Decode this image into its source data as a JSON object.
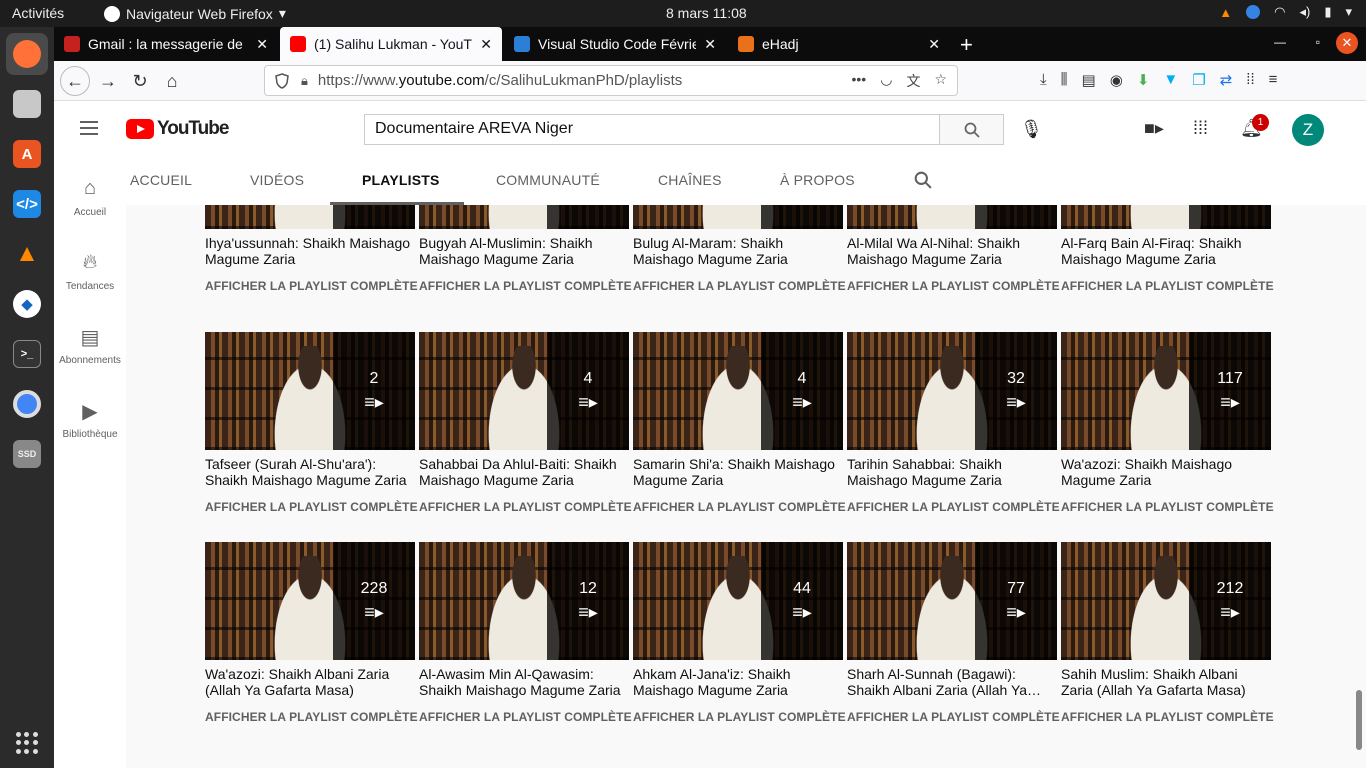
{
  "system": {
    "activities": "Activités",
    "app_menu": "Navigateur Web Firefox",
    "clock": "8 mars  11:08"
  },
  "browser": {
    "tabs": [
      {
        "title": "Gmail : la messagerie de",
        "color": "#c5221f"
      },
      {
        "title": "(1) Salihu Lukman - YouT",
        "color": "#ff0000"
      },
      {
        "title": "Visual Studio Code Févrie",
        "color": "#2b7fd6"
      },
      {
        "title": "eHadj",
        "color": "#e8711a"
      }
    ],
    "url_prefix": "https://www.",
    "url_domain": "youtube.com",
    "url_path": "/c/SalihuLukmanPhD/playlists"
  },
  "youtube": {
    "logo_text": "YouTube",
    "search_value": "Documentaire AREVA Niger",
    "notification_count": "1",
    "avatar_letter": "Z",
    "guide": [
      {
        "label": "Accueil",
        "icon": "home-icon"
      },
      {
        "label": "Tendances",
        "icon": "fire-icon"
      },
      {
        "label": "Abonnements",
        "icon": "subscriptions-icon"
      },
      {
        "label": "Bibliothèque",
        "icon": "library-icon"
      }
    ],
    "channel_tabs": [
      "ACCUEIL",
      "VIDÉOS",
      "PLAYLISTS",
      "COMMUNAUTÉ",
      "CHAÎNES",
      "À PROPOS"
    ],
    "active_tab": "PLAYLISTS",
    "view_full": "AFFICHER LA PLAYLIST COMPLÈTE",
    "rows": [
      [
        {
          "title": "Ihya'ussunnah: Shaikh Maishago Magume Zaria",
          "count": ""
        },
        {
          "title": "Bugyah Al-Muslimin: Shaikh Maishago Magume Zaria",
          "count": ""
        },
        {
          "title": "Bulug Al-Maram: Shaikh Maishago Magume Zaria",
          "count": ""
        },
        {
          "title": "Al-Milal Wa Al-Nihal: Shaikh Maishago Magume Zaria",
          "count": ""
        },
        {
          "title": "Al-Farq Bain Al-Firaq: Shaikh Maishago Magume Zaria",
          "count": ""
        }
      ],
      [
        {
          "title": "Tafseer (Surah Al-Shu'ara'): Shaikh Maishago Magume Zaria",
          "count": "2"
        },
        {
          "title": "Sahabbai Da Ahlul-Baiti: Shaikh Maishago Magume Zaria",
          "count": "4"
        },
        {
          "title": "Samarin Shi'a: Shaikh Maishago Magume Zaria",
          "count": "4"
        },
        {
          "title": "Tarihin Sahabbai: Shaikh Maishago Magume Zaria",
          "count": "32"
        },
        {
          "title": "Wa'azozi: Shaikh Maishago Magume Zaria",
          "count": "117"
        }
      ],
      [
        {
          "title": "Wa'azozi: Shaikh Albani Zaria (Allah Ya Gafarta Masa)",
          "count": "228"
        },
        {
          "title": "Al-Awasim Min Al-Qawasim: Shaikh Maishago Magume Zaria",
          "count": "12"
        },
        {
          "title": "Ahkam Al-Jana'iz: Shaikh Maishago Magume Zaria",
          "count": "44"
        },
        {
          "title": "Sharh Al-Sunnah (Bagawi): Shaikh Albani Zaria (Allah Ya…",
          "count": "77"
        },
        {
          "title": "Sahih Muslim: Shaikh Albani Zaria (Allah Ya Gafarta Masa)",
          "count": "212"
        }
      ]
    ]
  }
}
